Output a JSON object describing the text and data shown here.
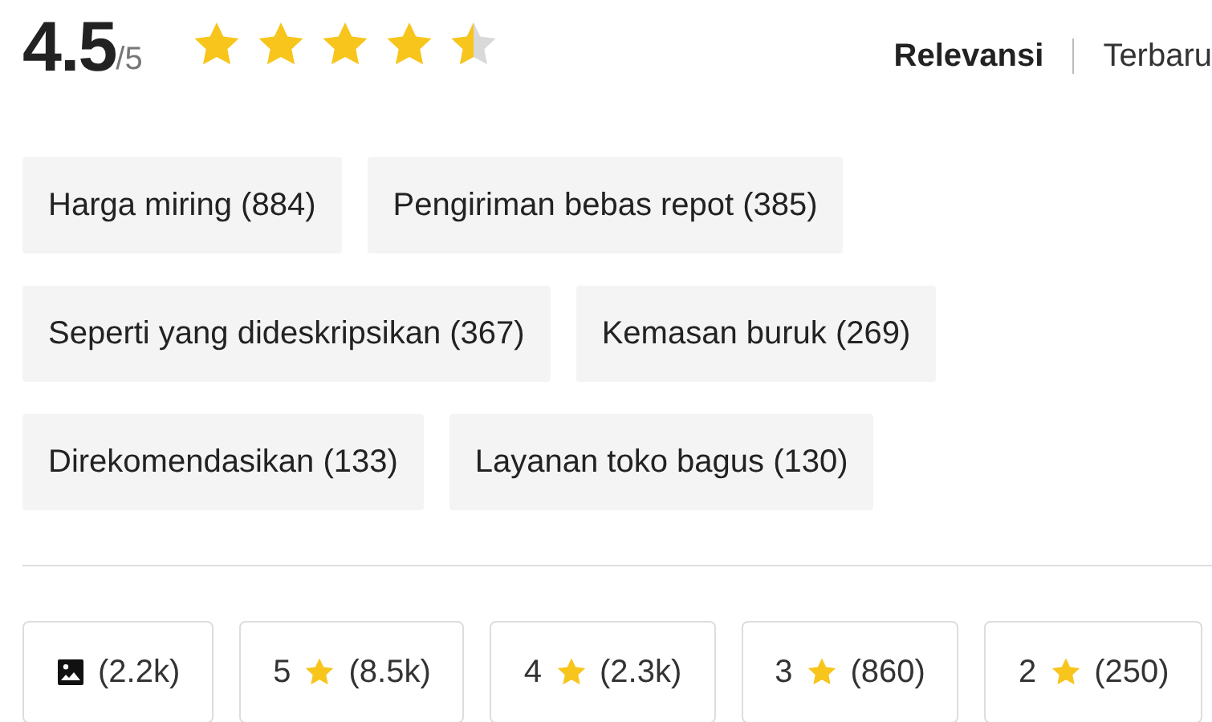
{
  "rating": {
    "score": "4.5",
    "out_of": "/5",
    "stars": 4.5
  },
  "sort_options": [
    {
      "label": "Relevansi",
      "selected": true
    },
    {
      "label": "Terbaru",
      "selected": false
    }
  ],
  "tags": [
    {
      "label": "Harga miring (884)"
    },
    {
      "label": "Pengiriman bebas repot (385)"
    },
    {
      "label": "Seperti yang dideskripsikan (367)"
    },
    {
      "label": "Kemasan buruk (269)"
    },
    {
      "label": "Direkomendasikan (133)"
    },
    {
      "label": "Layanan toko bagus (130)"
    }
  ],
  "filters": [
    {
      "kind": "photo",
      "count": "(2.2k)"
    },
    {
      "kind": "star",
      "stars_label": "5",
      "count": "(8.5k)"
    },
    {
      "kind": "star",
      "stars_label": "4",
      "count": "(2.3k)"
    },
    {
      "kind": "star",
      "stars_label": "3",
      "count": "(860)"
    },
    {
      "kind": "star",
      "stars_label": "2",
      "count": "(250)"
    }
  ]
}
